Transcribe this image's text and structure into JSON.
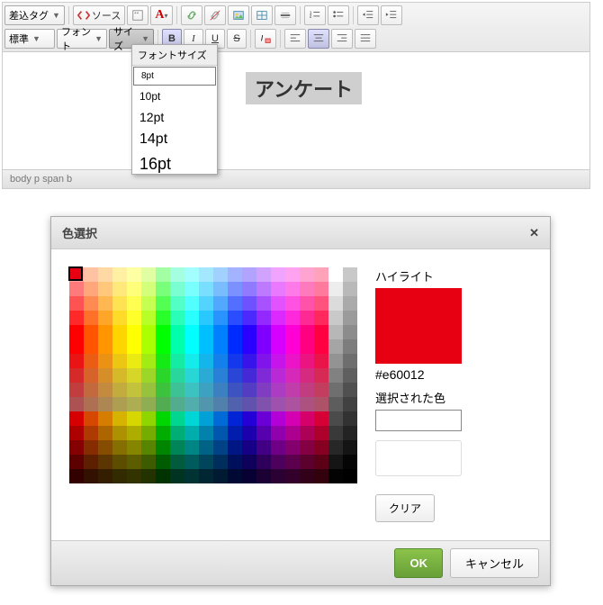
{
  "toolbar": {
    "merge_tag": "差込タグ",
    "source": "ソース",
    "format": "標準",
    "font": "フォント",
    "size": "サイズ"
  },
  "fontsize": {
    "title": "フォントサイズ",
    "items": [
      "8pt",
      "10pt",
      "12pt",
      "14pt",
      "16pt"
    ],
    "selected": "8pt"
  },
  "content": {
    "heading": "アンケート"
  },
  "path": "body   p   span   b",
  "dialog": {
    "title": "色選択",
    "highlight_label": "ハイライト",
    "hex": "#e60012",
    "selected_label": "選択された色",
    "clear": "クリア",
    "ok": "OK",
    "cancel": "キャンセル"
  },
  "palette_hues": [
    0,
    18,
    36,
    54,
    72,
    108,
    144,
    162,
    180,
    198,
    216,
    252,
    288,
    306,
    324
  ],
  "palette_lightness": [
    85,
    78,
    71,
    64,
    57,
    50,
    50,
    50,
    50,
    50,
    50,
    50,
    50,
    50,
    50,
    43,
    36,
    29,
    22,
    15
  ],
  "palette_sat": [
    100,
    100,
    100,
    100,
    100,
    100,
    90,
    80,
    70,
    60,
    50,
    40,
    30,
    20,
    10,
    100,
    100,
    100,
    100,
    100
  ]
}
